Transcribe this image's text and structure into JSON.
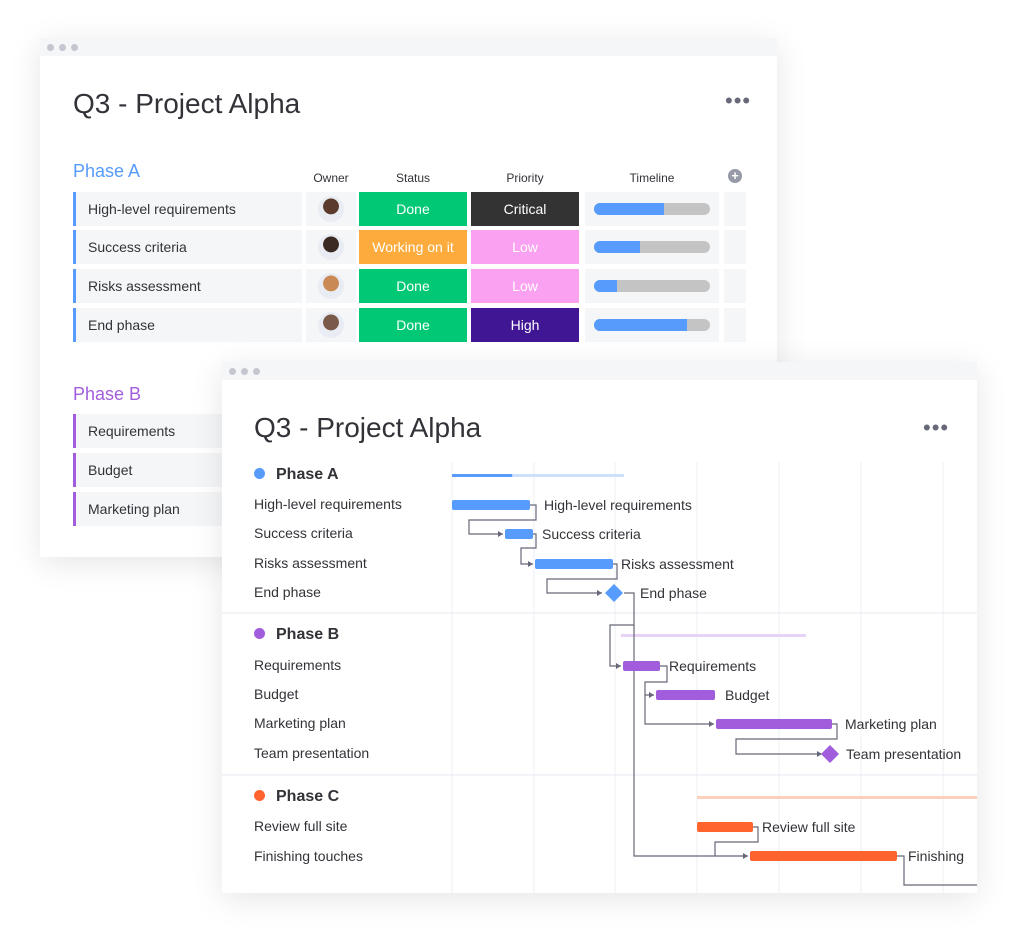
{
  "table_view": {
    "title": "Q3 - Project Alpha",
    "more_icon": "more-horizontal-icon",
    "columns": {
      "owner": "Owner",
      "status": "Status",
      "priority": "Priority",
      "timeline": "Timeline"
    },
    "add_column_icon": "plus-circle-icon",
    "phase_a": {
      "label": "Phase A",
      "color": "#579bfc",
      "rows": [
        {
          "name": "High-level requirements",
          "status": "Done",
          "status_color": "#00c875",
          "priority": "Critical",
          "priority_color": "#333333",
          "timeline_progress": 0.6
        },
        {
          "name": "Success criteria",
          "status": "Working on it",
          "status_color": "#fdab3d",
          "priority": "Low",
          "priority_color": "#faa1f1",
          "timeline_progress": 0.4
        },
        {
          "name": "Risks assessment",
          "status": "Done",
          "status_color": "#00c875",
          "priority": "Low",
          "priority_color": "#faa1f1",
          "timeline_progress": 0.2
        },
        {
          "name": "End phase",
          "status": "Done",
          "status_color": "#00c875",
          "priority": "High",
          "priority_color": "#401694",
          "timeline_progress": 0.8
        }
      ]
    },
    "phase_b": {
      "label": "Phase B",
      "color": "#a25ddc",
      "rows": [
        {
          "name": "Requirements"
        },
        {
          "name": "Budget"
        },
        {
          "name": "Marketing plan"
        }
      ]
    }
  },
  "gantt_view": {
    "title": "Q3 - Project Alpha",
    "more_icon": "more-horizontal-icon",
    "phases": [
      {
        "label": "Phase A",
        "color": "#579bfc",
        "summary_progress": 0.35,
        "tasks": [
          "High-level requirements",
          "Success criteria",
          "Risks assessment",
          "End phase"
        ]
      },
      {
        "label": "Phase B",
        "color": "#a25ddc",
        "tasks": [
          "Requirements",
          "Budget",
          "Marketing plan",
          "Team presentation"
        ]
      },
      {
        "label": "Phase C",
        "color": "#ff642e",
        "tasks": [
          "Review full site",
          "Finishing touches"
        ]
      }
    ],
    "bar_labels": {
      "c1": "Finishing"
    }
  }
}
